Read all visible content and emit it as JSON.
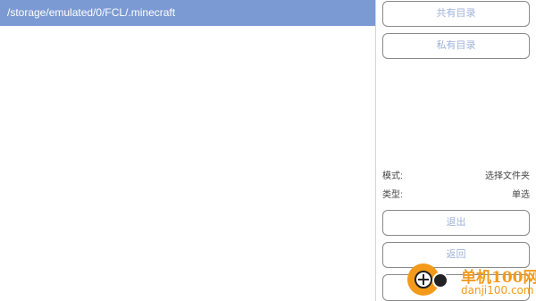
{
  "path_bar": {
    "text": "/storage/emulated/0/FCL/.minecraft"
  },
  "buttons": {
    "shared_dir": "共有目录",
    "private_dir": "私有目录",
    "exit": "退出",
    "back": "返回",
    "confirm": ""
  },
  "info": {
    "mode_label": "模式:",
    "mode_value": "选择文件夹",
    "type_label": "类型:",
    "type_value": "单选"
  },
  "watermark": {
    "brand": "单机100网",
    "domain": "danji100.com"
  },
  "colors": {
    "accent": "#7b9ad3",
    "button_text": "#9fb3d9",
    "watermark": "#f39a1b"
  }
}
